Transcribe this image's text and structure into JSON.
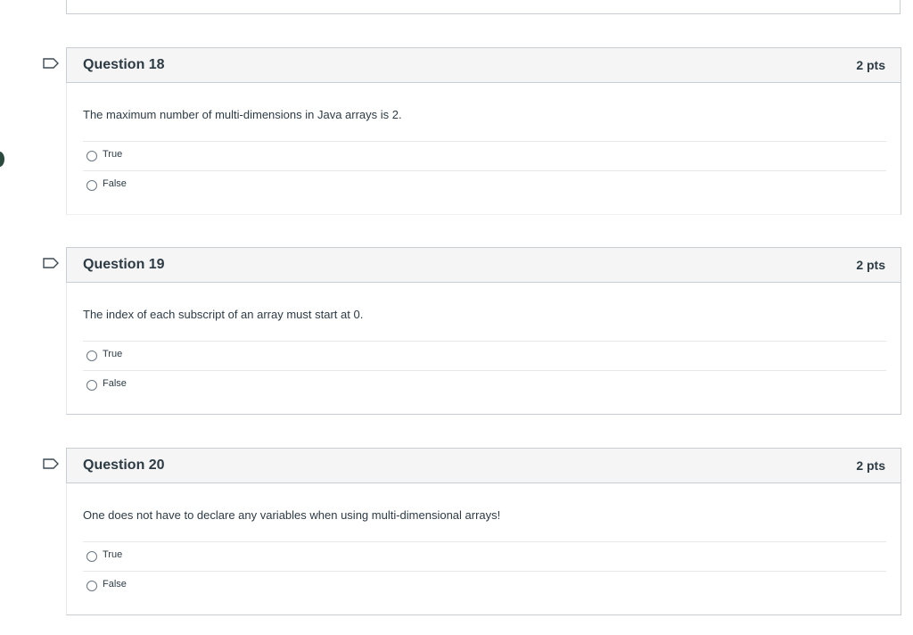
{
  "questions": [
    {
      "title": "Question 18",
      "points": "2 pts",
      "text": "The maximum number of multi-dimensions in Java arrays is 2.",
      "options": [
        "True",
        "False"
      ]
    },
    {
      "title": "Question 19",
      "points": "2 pts",
      "text": "The index of each subscript of an array must start at 0.",
      "options": [
        "True",
        "False"
      ]
    },
    {
      "title": "Question 20",
      "points": "2 pts",
      "text": "One does not have to declare any variables when using multi-dimensional arrays!",
      "options": [
        "True",
        "False"
      ]
    }
  ],
  "icons": {
    "flag": "flag-icon",
    "radio": "radio-unchecked-icon"
  },
  "colors": {
    "header_bg": "#f5f5f5",
    "border": "#c7cdd1",
    "text": "#2d3b45"
  }
}
